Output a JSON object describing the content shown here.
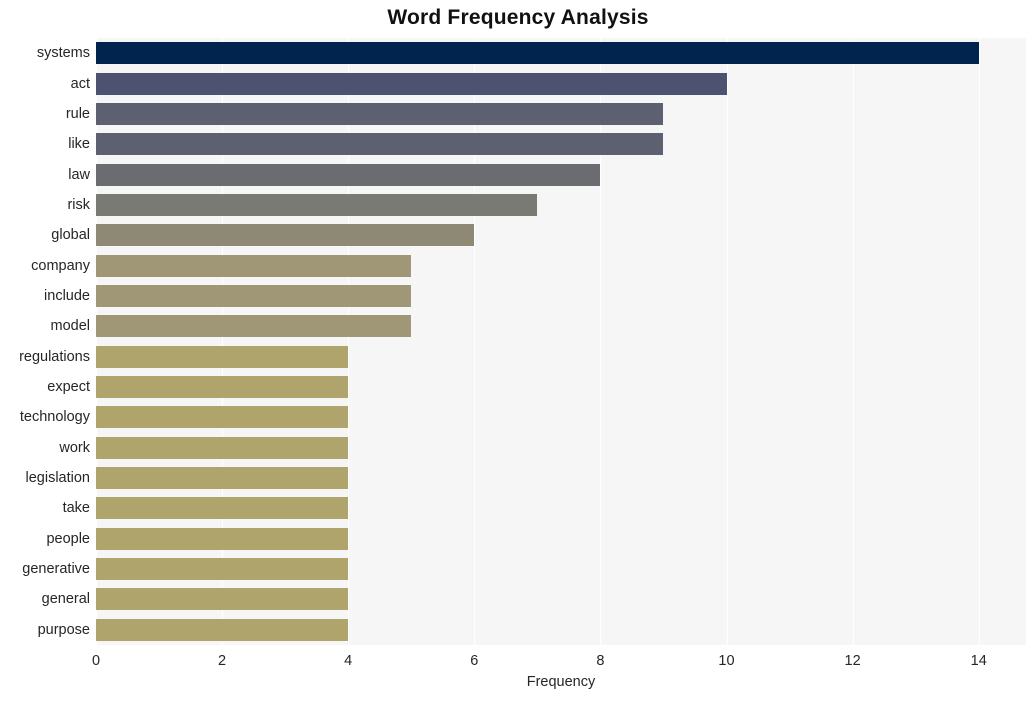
{
  "chart_data": {
    "type": "bar",
    "orientation": "horizontal",
    "title": "Word Frequency Analysis",
    "xlabel": "Frequency",
    "ylabel": "",
    "xlim": [
      0,
      14.75
    ],
    "ylim": [
      0,
      20
    ],
    "grid": true,
    "legend": null,
    "xticks": [
      0,
      2,
      4,
      6,
      8,
      10,
      12,
      14
    ],
    "xtick_labels": [
      "0",
      "2",
      "4",
      "6",
      "8",
      "10",
      "12",
      "14"
    ],
    "categories": [
      "systems",
      "act",
      "rule",
      "like",
      "law",
      "risk",
      "global",
      "company",
      "include",
      "model",
      "regulations",
      "expect",
      "technology",
      "work",
      "legislation",
      "take",
      "people",
      "generative",
      "general",
      "purpose"
    ],
    "values": [
      14,
      10,
      9,
      9,
      8,
      7,
      6,
      5,
      5,
      5,
      4,
      4,
      4,
      4,
      4,
      4,
      4,
      4,
      4,
      4
    ],
    "bar_colors": [
      "#01244e",
      "#4c5270",
      "#5c6070",
      "#5c6070",
      "#6b6c70",
      "#7a7a74",
      "#8e8974",
      "#9f9775",
      "#9f9775",
      "#9f9775",
      "#b0a46d",
      "#b0a46d",
      "#b0a46d",
      "#b0a46d",
      "#b0a46d",
      "#b0a46d",
      "#b0a46d",
      "#b0a46d",
      "#b0a46d",
      "#b0a46d"
    ],
    "plot_background": "#f6f6f7",
    "figure_background": "#ffffff",
    "gridline_color": "#ffffff"
  }
}
